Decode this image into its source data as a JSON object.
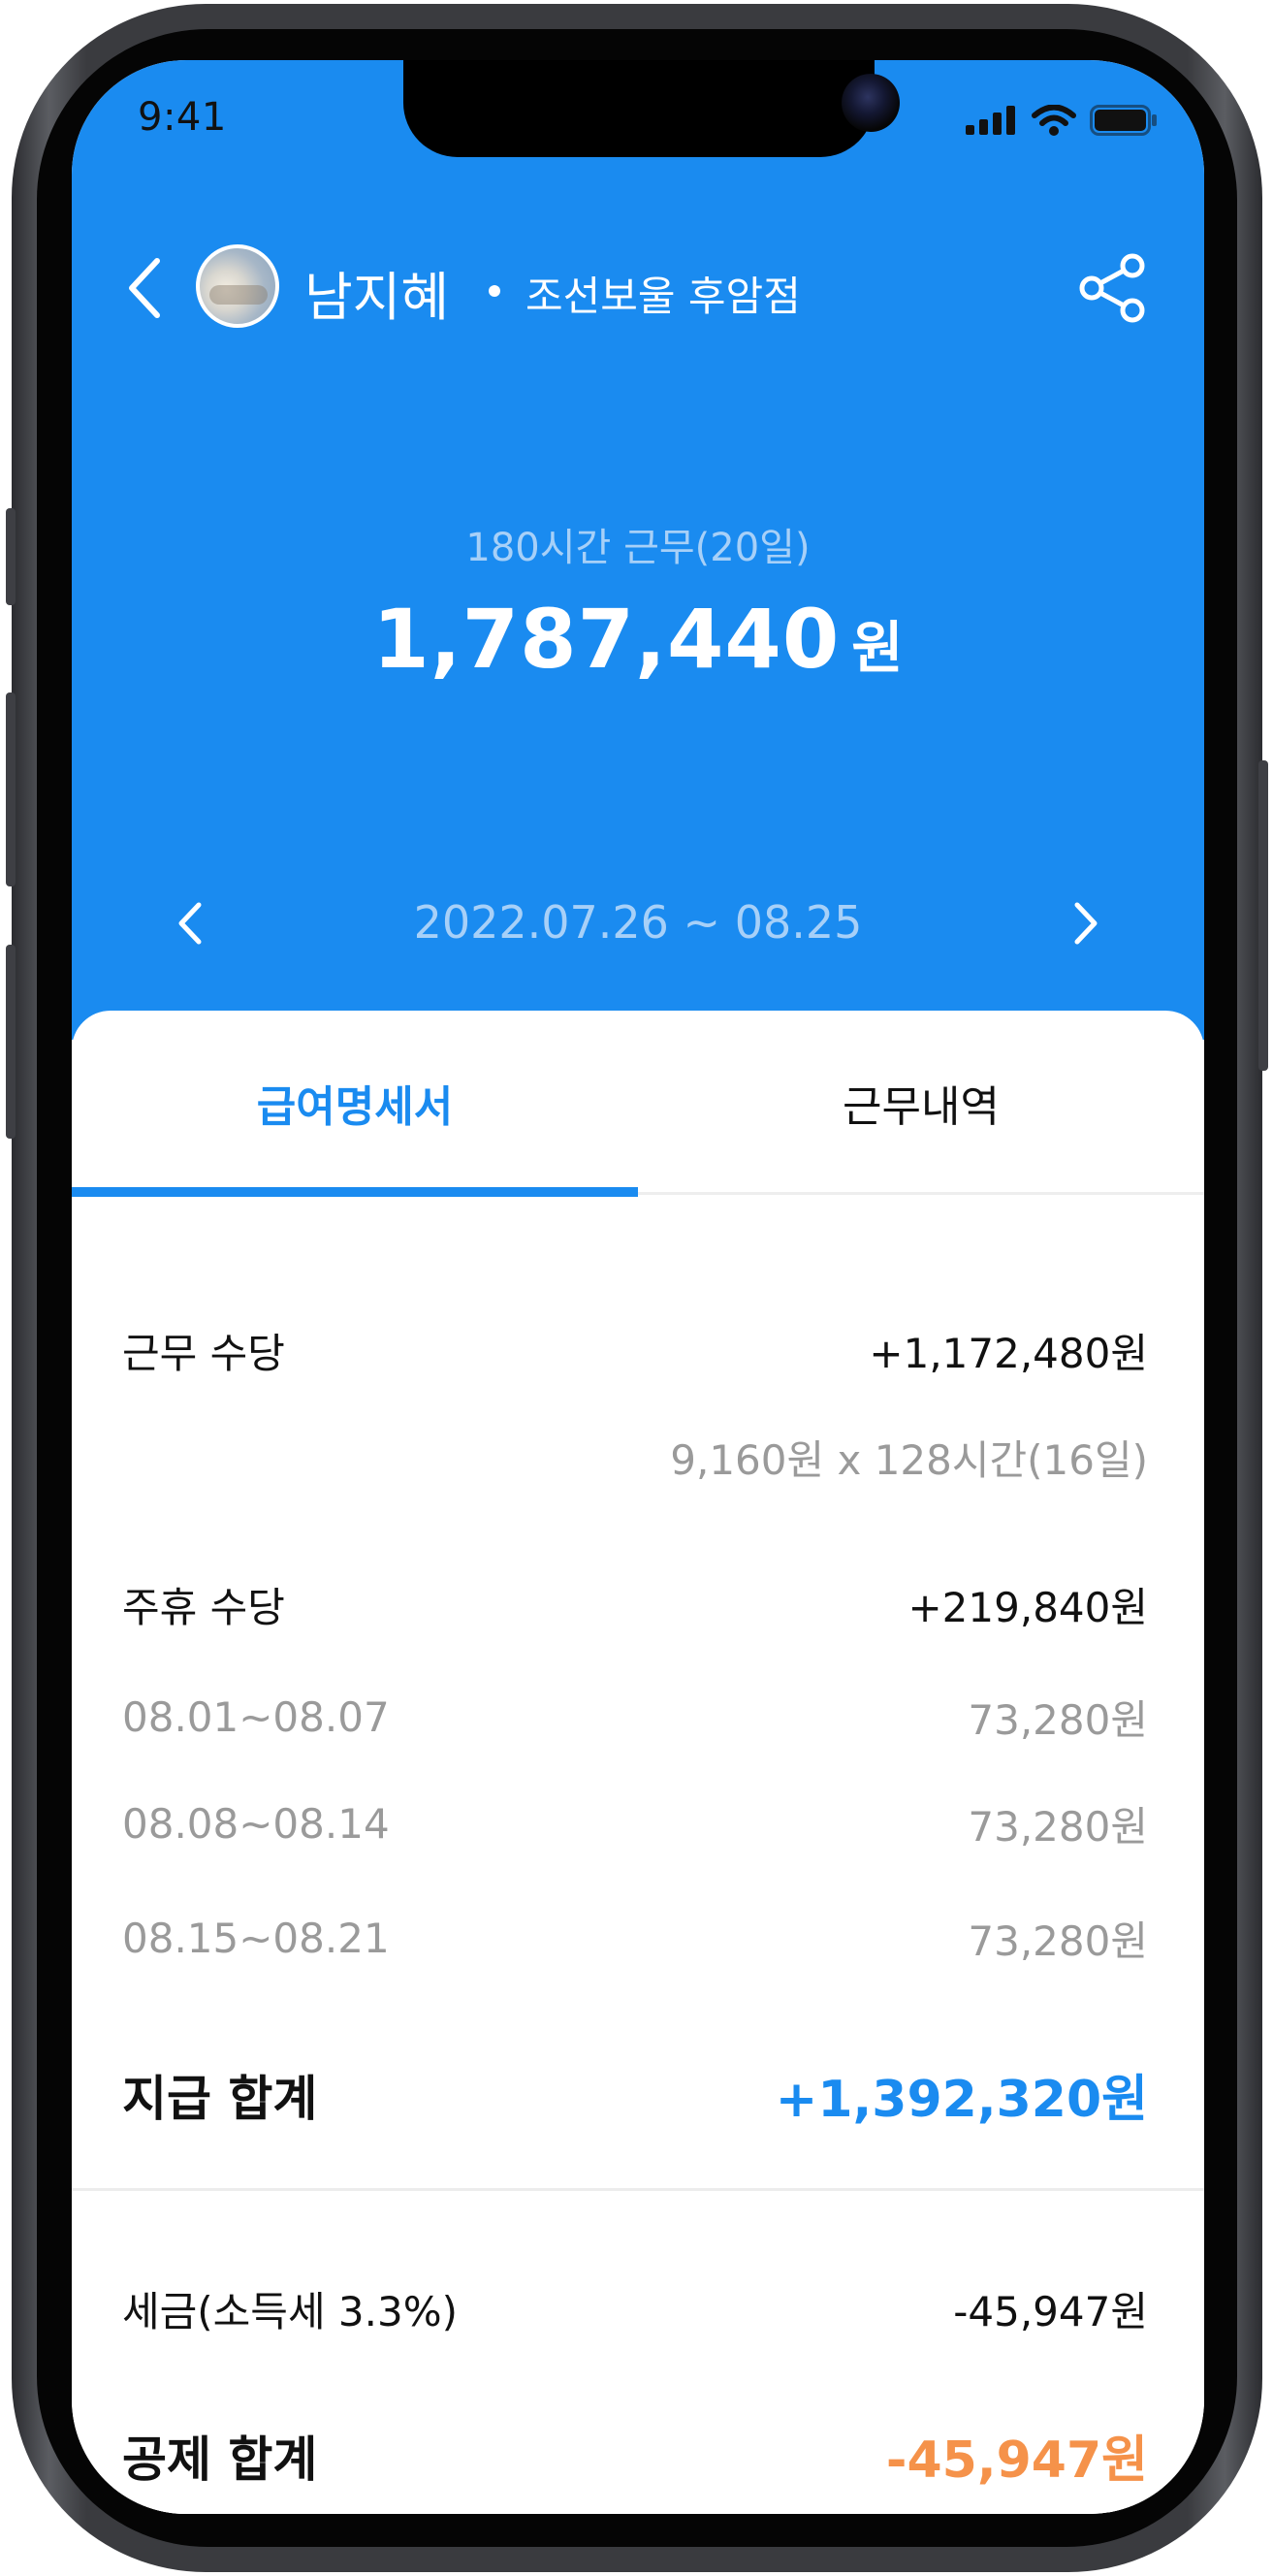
{
  "status_bar": {
    "time": "9:41"
  },
  "header": {
    "user_name": "남지혜",
    "store_name": "조선보울 후암점",
    "work_summary": "180시간 근무(20일)",
    "total_amount": "1,787,440",
    "total_unit": "원",
    "period": "2022.07.26 ~ 08.25"
  },
  "tabs": [
    {
      "label": "급여명세서",
      "active": true
    },
    {
      "label": "근무내역",
      "active": false
    }
  ],
  "payslip": {
    "work_allowance": {
      "label": "근무 수당",
      "value": "+1,172,480원",
      "detail": "9,160원 x 128시간(16일)"
    },
    "weekly_allowance": {
      "label": "주휴 수당",
      "value": "+219,840원",
      "weeks": [
        {
          "range": "08.01~08.07",
          "amount": "73,280원"
        },
        {
          "range": "08.08~08.14",
          "amount": "73,280원"
        },
        {
          "range": "08.15~08.21",
          "amount": "73,280원"
        }
      ]
    },
    "pay_total": {
      "label": "지급 합계",
      "value": "+1,392,320원"
    },
    "tax": {
      "label": "세금(소득세 3.3%)",
      "value": "-45,947원"
    },
    "deduction_total": {
      "label": "공제 합계",
      "value": "-45,947원"
    }
  },
  "colors": {
    "primary_blue": "#1a8bf0",
    "pay_total_blue": "#1a8bf0",
    "deduction_orange": "#f5924a",
    "muted_text": "#9a9a9a"
  },
  "icons": [
    "back-chevron-icon",
    "share-icon",
    "prev-period-chevron-icon",
    "next-period-chevron-icon",
    "signal-icon",
    "wifi-icon",
    "battery-icon"
  ]
}
